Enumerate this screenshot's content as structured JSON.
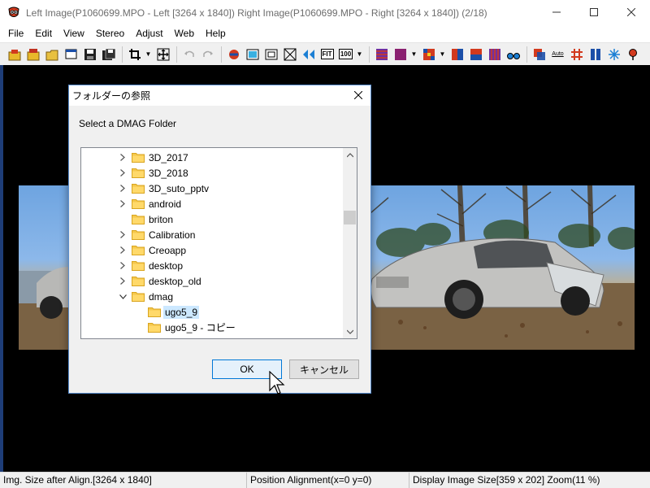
{
  "window": {
    "title": "Left Image(P1060699.MPO - Left [3264 x 1840]) Right Image(P1060699.MPO - Right [3264 x 1840])  (2/18)",
    "minimize_icon": "minimize-icon",
    "maximize_icon": "maximize-icon",
    "close_icon": "close-icon"
  },
  "menu": {
    "items": [
      "File",
      "Edit",
      "View",
      "Stereo",
      "Adjust",
      "Web",
      "Help"
    ]
  },
  "toolbar": {
    "fit_label": "FIT",
    "zoom100_label": "100",
    "auto_label": "Auto"
  },
  "dialog": {
    "title": "フォルダーの参照",
    "prompt": "Select a DMAG Folder",
    "folders": [
      {
        "label": "3D_2017",
        "expandable": true
      },
      {
        "label": "3D_2018",
        "expandable": true
      },
      {
        "label": "3D_suto_pptv",
        "expandable": true
      },
      {
        "label": "android",
        "expandable": true
      },
      {
        "label": "briton",
        "expandable": false
      },
      {
        "label": "Calibration",
        "expandable": true
      },
      {
        "label": "Creoapp",
        "expandable": true
      },
      {
        "label": "desktop",
        "expandable": true
      },
      {
        "label": "desktop_old",
        "expandable": true
      },
      {
        "label": "dmag",
        "expandable": true,
        "expanded": true
      },
      {
        "label": "ugo5_9",
        "expandable": false,
        "selected": true
      },
      {
        "label": "ugo5_9 - コピー",
        "expandable": false
      }
    ],
    "ok_label": "OK",
    "cancel_label": "キャンセル"
  },
  "status": {
    "img_size": "Img. Size after Align.[3264 x 1840]",
    "position": "Position Alignment(x=0 y=0)",
    "display": "Display Image Size[359 x 202]  Zoom(11 %)"
  },
  "colors": {
    "accent": "#0078d7",
    "selection": "#cce8ff",
    "folder": "#f5c84c"
  }
}
